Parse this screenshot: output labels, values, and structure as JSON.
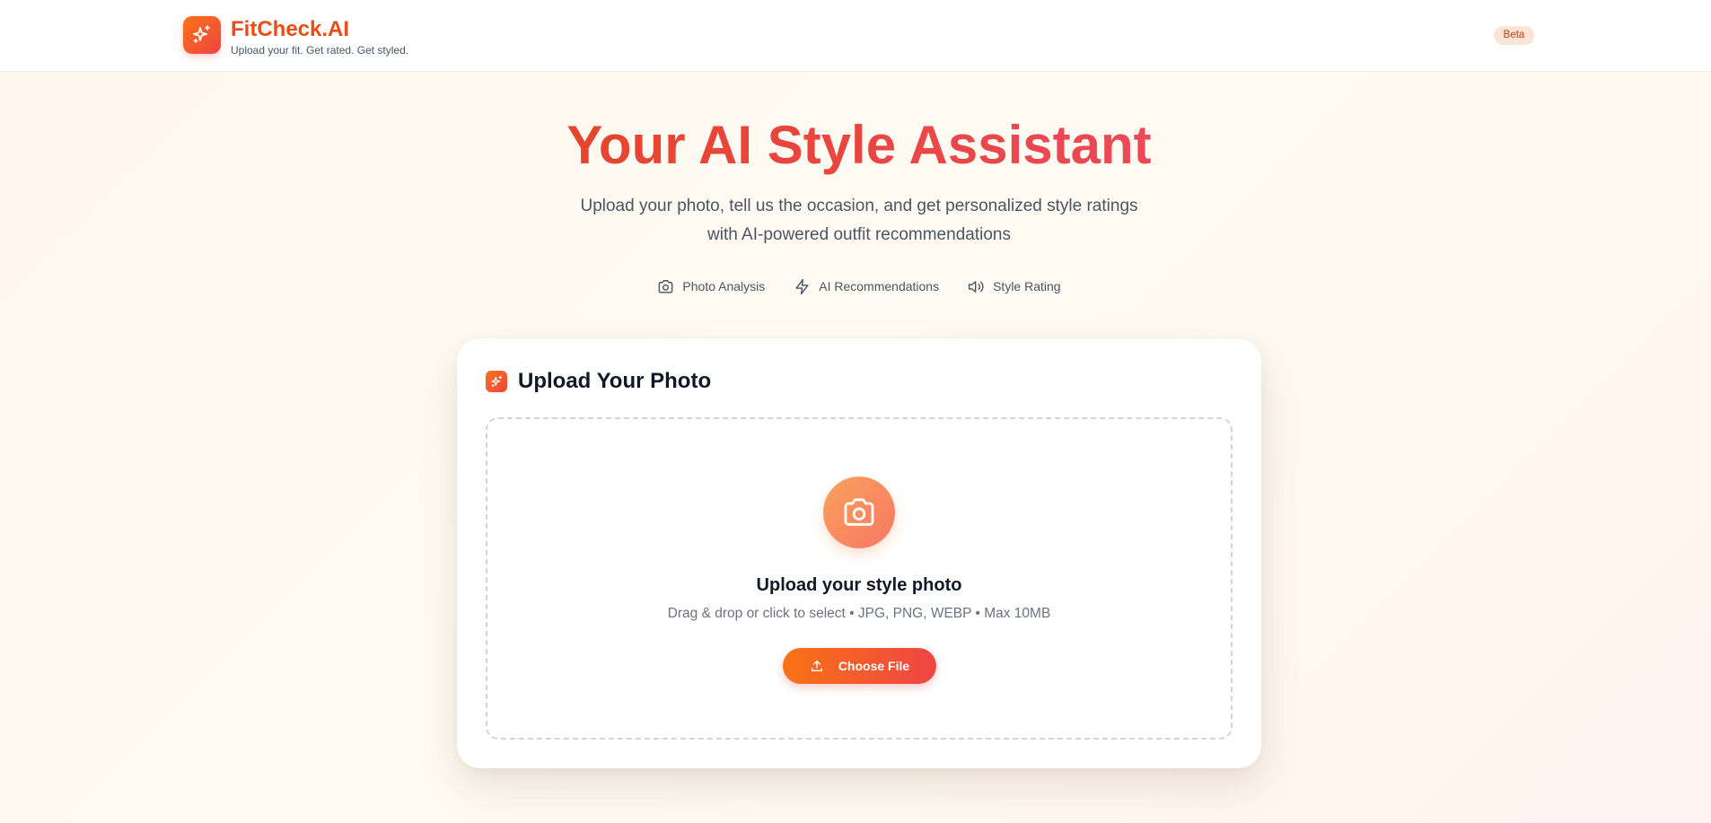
{
  "header": {
    "brand_name": "FitCheck.AI",
    "tagline": "Upload your fit. Get rated. Get styled.",
    "badge": "Beta",
    "logo_icon": "sparkles-icon"
  },
  "hero": {
    "title": "Your AI Style Assistant",
    "subtitle_line1": "Upload your photo, tell us the occasion, and get personalized style ratings",
    "subtitle_line2": "with AI-powered outfit recommendations",
    "features": [
      {
        "label": "Photo Analysis",
        "icon": "camera-icon"
      },
      {
        "label": "AI Recommendations",
        "icon": "lightning-icon"
      },
      {
        "label": "Style Rating",
        "icon": "volume-icon"
      }
    ]
  },
  "upload_card": {
    "title": "Upload Your Photo",
    "title_icon": "sparkles-icon",
    "dropzone": {
      "icon": "camera-icon",
      "title": "Upload your style photo",
      "hint": "Drag & drop or click to select • JPG, PNG, WEBP • Max 10MB",
      "button_label": "Choose File",
      "button_icon": "upload-icon"
    }
  },
  "colors": {
    "brand_orange": "#f97316",
    "brand_red": "#ef4444",
    "title_gradient_start": "#e6452c",
    "title_gradient_end": "#ec4858",
    "badge_bg": "#fde4d6",
    "badge_text": "#c2410c"
  }
}
